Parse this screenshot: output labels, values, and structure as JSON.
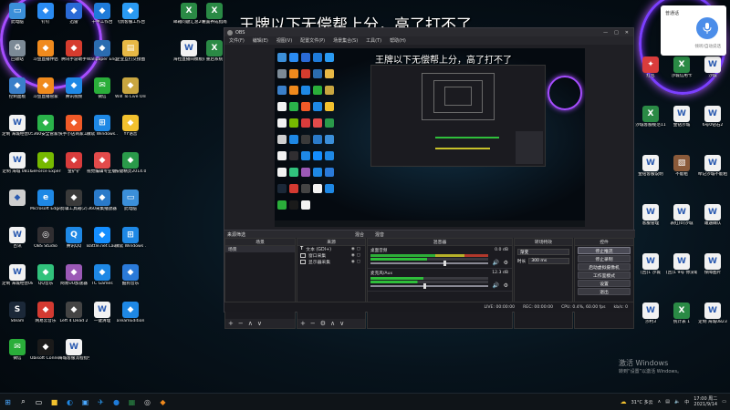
{
  "colors": {
    "ring": "#a64dff",
    "obs_bg": "#1f1f24",
    "meter_green": "#2fbf3b",
    "meter_yellow": "#c8c22a",
    "meter_red": "#c23b2c",
    "taskbar": "#0f1418",
    "mic_blue": "#4b8de9"
  },
  "overlay_caption": "王牌以下无偿帮上分，高了打不了",
  "preview_caption": "王牌以下无偿帮上分，高了打不了",
  "desktop": {
    "left_icons": [
      {
        "label": "此电脑",
        "icon": "computer-icon",
        "color": "#3b8fd9"
      },
      {
        "label": "钉钉",
        "icon": "dingtalk-icon",
        "color": "#2a8bf2"
      },
      {
        "label": "迅雷",
        "icon": "thunder-icon",
        "color": "#2a6ad6"
      },
      {
        "label": "千牛工作台",
        "icon": "qianniu-icon",
        "color": "#1e7bd9"
      },
      {
        "label": "飞鸽客服工作台",
        "icon": "feige-icon",
        "color": "#2a9af2"
      },
      {
        "label": "回收站",
        "icon": "recycle-bin-icon",
        "color": "#7c8a96"
      },
      {
        "label": "斗鱼直播伴侣",
        "icon": "douyu-icon",
        "color": "#f08a1d"
      },
      {
        "label": "腾讯手游助手",
        "icon": "tencent-game-icon",
        "color": "#d63c2e"
      },
      {
        "label": "Wallpaper Engine:...",
        "icon": "wallpaper-engine-icon",
        "color": "#2b6cb0"
      },
      {
        "label": "企业互打交接图",
        "icon": "folder-icon",
        "color": "#e8b845"
      },
      {
        "label": "控制面板",
        "icon": "control-panel-icon",
        "color": "#3a7fc9"
      },
      {
        "label": "斗鱼直播管家",
        "icon": "douyu-manager-icon",
        "color": "#f08a1d"
      },
      {
        "label": "腾讯视频",
        "icon": "tencent-video-icon",
        "color": "#1e88e5"
      },
      {
        "label": "微信",
        "icon": "wechat-icon",
        "color": "#2aae3a"
      },
      {
        "label": "Will To Live Online",
        "icon": "will-to-live-icon",
        "color": "#c9a640"
      },
      {
        "label": "定制 海城经营0518",
        "icon": "doc-icon",
        "color": "#f2f2f2"
      },
      {
        "label": "360安全管家",
        "icon": "360-icon",
        "color": "#2ab34a"
      },
      {
        "label": "快手小店商家工作台",
        "icon": "kuaishou-icon",
        "color": "#f05a28"
      },
      {
        "label": "微软 Windows...",
        "icon": "windows-icon",
        "color": "#1e88e5"
      },
      {
        "label": "YY语音",
        "icon": "yy-icon",
        "color": "#f2c12e"
      },
      {
        "label": "定制 海城 0811",
        "icon": "doc-icon",
        "color": "#f2f2f2"
      },
      {
        "label": "GeForce Experience",
        "icon": "geforce-icon",
        "color": "#76b900"
      },
      {
        "label": "金铲铲",
        "icon": "game-icon",
        "color": "#d93c3c"
      },
      {
        "label": "视觉编辑专业版 9.0",
        "icon": "editor-icon",
        "color": "#e34b4b"
      },
      {
        "label": "按键精灵2014.06",
        "icon": "key-sprite-icon",
        "color": "#2a9a4a"
      },
      {
        "label": "",
        "icon": "blank-icon",
        "color": "#cfcfcf"
      },
      {
        "label": "Microsoft Edge",
        "icon": "edge-icon",
        "color": "#1e88e5"
      },
      {
        "label": "剪辑工具箱(2)",
        "icon": "toolbox-icon",
        "color": "#3a3a3a"
      },
      {
        "label": "360采集播放器",
        "icon": "360-player-icon",
        "color": "#2a7ac9"
      },
      {
        "label": "此电脑",
        "icon": "computer-icon",
        "color": "#3b8fd9"
      },
      {
        "label": "百讯",
        "icon": "doc-icon",
        "color": "#f2f2f2"
      },
      {
        "label": "OBS Studio",
        "icon": "obs-icon",
        "color": "#302e31"
      },
      {
        "label": "腾讯QQ",
        "icon": "qq-icon",
        "color": "#1e88e5"
      },
      {
        "label": "Battle.net Launcher",
        "icon": "battlenet-icon",
        "color": "#148eff"
      },
      {
        "label": "微软 Windows ...",
        "icon": "windows-icon",
        "color": "#1e88e5"
      },
      {
        "label": "定制 海城经营0820新版",
        "icon": "doc-icon",
        "color": "#f2f2f2"
      },
      {
        "label": "QQ音乐",
        "icon": "qq-music-icon",
        "color": "#31c27c"
      },
      {
        "label": "网易UU加速器",
        "icon": "uu-icon",
        "color": "#9b59b6"
      },
      {
        "label": "TC Games",
        "icon": "tc-games-icon",
        "color": "#1e88e5"
      },
      {
        "label": "酷狗音乐",
        "icon": "kugou-icon",
        "color": "#2a7ad9"
      },
      {
        "label": "Steam",
        "icon": "steam-icon",
        "color": "#1b2838"
      },
      {
        "label": "网易云音乐",
        "icon": "netease-music-icon",
        "color": "#d33a31"
      },
      {
        "label": "Left 4 Dead 2",
        "icon": "l4d2-icon",
        "color": "#444"
      },
      {
        "label": "一键清理",
        "icon": "doc-icon",
        "color": "#f2f2f2"
      },
      {
        "label": "aTeamEdition",
        "icon": "ateam-icon",
        "color": "#1e88e5"
      },
      {
        "label": "微信",
        "icon": "wechat-icon",
        "color": "#2aae3a"
      },
      {
        "label": "Ubisoft Connect",
        "icon": "ubisoft-icon",
        "color": "#1a1a1a"
      },
      {
        "label": "海城客服流程指引20210121",
        "icon": "doc-icon",
        "color": "#f2f2f2"
      }
    ],
    "top_icons": [
      {
        "label": "邮箱问题汇总20210727",
        "icon": "excel-icon",
        "color": "#2a8a45"
      },
      {
        "label": "重置养成指南",
        "icon": "excel-icon",
        "color": "#2a8a45"
      },
      {
        "label": "海拉直播间模板式数据",
        "icon": "doc-icon",
        "color": "#f2f2f2"
      },
      {
        "label": "重启系统",
        "icon": "excel-icon",
        "color": "#2a8a45"
      }
    ],
    "right_icons": [
      {
        "label": "红包",
        "icon": "gift-icon",
        "color": "#d93c3c"
      },
      {
        "label": "沙城信用卡",
        "icon": "excel-icon",
        "color": "#2a8a45"
      },
      {
        "label": "沙城",
        "icon": "doc-icon",
        "color": "#f2f2f2"
      },
      {
        "label": "沙城客服规范11",
        "icon": "excel-icon",
        "color": "#2a8a45"
      },
      {
        "label": "金钻沙城",
        "icon": "doc-icon",
        "color": "#f2f2f2"
      },
      {
        "label": "6号0钻石2",
        "icon": "doc-icon",
        "color": "#f2f2f2"
      },
      {
        "label": "金钻客服说明",
        "icon": "doc-icon",
        "color": "#f2f2f2"
      },
      {
        "label": "不能租",
        "icon": "image-icon",
        "color": "#8a5a3a"
      },
      {
        "label": "牵记沙城不能租",
        "icon": "doc-icon",
        "color": "#f2f2f2"
      },
      {
        "label": "客服管理",
        "icon": "doc-icon",
        "color": "#f2f2f2"
      },
      {
        "label": "表红(0)沙城",
        "icon": "doc-icon",
        "color": "#f2f2f2"
      },
      {
        "label": "遭遇确认",
        "icon": "doc-icon",
        "color": "#f2f2f2"
      },
      {
        "label": "[回]1 沙城",
        "icon": "doc-icon",
        "color": "#f2f2f2"
      },
      {
        "label": "[回]1 9号 你没取消吗",
        "icon": "doc-icon",
        "color": "#f2f2f2"
      },
      {
        "label": "保障图片",
        "icon": "doc-icon",
        "color": "#f2f2f2"
      },
      {
        "label": "沙村3",
        "icon": "doc-icon",
        "color": "#f2f2f2"
      },
      {
        "label": "统计表 1",
        "icon": "excel-icon",
        "color": "#2a8a45"
      },
      {
        "label": "定制 海城0823",
        "icon": "doc-icon",
        "color": "#f2f2f2"
      }
    ]
  },
  "obs": {
    "title": "OBS",
    "window_buttons": [
      "—",
      "□",
      "✕"
    ],
    "menu": [
      "文件(F)",
      "编辑(E)",
      "视图(V)",
      "配置文件(P)",
      "场景集合(S)",
      "工具(T)",
      "帮助(H)"
    ],
    "sections": {
      "scenes_strip": "来源筛选",
      "audio_icon_label": "混合",
      "audio2_label": "混音"
    },
    "panels": {
      "scenes": {
        "header": "场景",
        "items": [
          "场景"
        ]
      },
      "sources": {
        "header": "来源",
        "items": [
          {
            "label": "文本 (GDI+)",
            "icon": "text-icon"
          },
          {
            "label": "窗口采集",
            "icon": "window-icon"
          },
          {
            "label": "显示器采集",
            "icon": "monitor-icon"
          }
        ]
      },
      "mixer": {
        "header": "混音器",
        "rows": [
          {
            "label": "桌面音频",
            "db": "0.0 dB",
            "level": 0.62
          },
          {
            "label": "麦克风/Aux",
            "db": "12.3 dB",
            "level": 0.45
          }
        ]
      },
      "transitions": {
        "header": "转场特效",
        "type": "渐变",
        "duration_label": "时长",
        "duration": "300 ms"
      },
      "controls": {
        "header": "控件",
        "buttons": [
          "停止推流",
          "停止录制",
          "启动虚拟摄像机",
          "工作室模式",
          "设置",
          "退出"
        ]
      }
    },
    "status": {
      "live": "LIVE: 00:00:00",
      "rec": "REC: 00:00:00",
      "cpu": "CPU: 0.4%, 60.00 fps",
      "kbps": "kb/s: 0"
    }
  },
  "voice_panel": {
    "title": "普通话",
    "subtitle": "倾听/自动说话"
  },
  "taskbar": {
    "weather": "31°C 多云",
    "time": "17:00",
    "day": "周二",
    "date": "2021/9/14",
    "ime": "中"
  },
  "watermark": {
    "title": "激活 Windows",
    "subtitle": "转到“设置”以激活 Windows。"
  }
}
